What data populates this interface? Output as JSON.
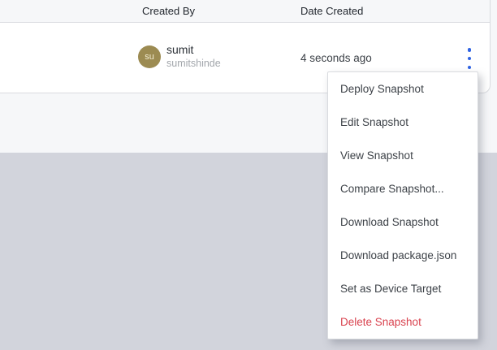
{
  "table": {
    "columns": [
      "Created By",
      "Date Created"
    ],
    "row": {
      "user": {
        "avatar_initials": "su",
        "name": "sumit",
        "username": "sumitshinde"
      },
      "date_created": "4 seconds ago"
    }
  },
  "menu": {
    "items": [
      {
        "label": "Deploy Snapshot",
        "danger": false
      },
      {
        "label": "Edit Snapshot",
        "danger": false
      },
      {
        "label": "View Snapshot",
        "danger": false
      },
      {
        "label": "Compare Snapshot...",
        "danger": false
      },
      {
        "label": "Download Snapshot",
        "danger": false
      },
      {
        "label": "Download package.json",
        "danger": false
      },
      {
        "label": "Set as Device Target",
        "danger": false
      },
      {
        "label": "Delete Snapshot",
        "danger": true
      }
    ]
  },
  "icons": {
    "kebab": "kebab-menu-icon"
  },
  "colors": {
    "header_bg": "#f6f7f9",
    "border": "#d9dbdf",
    "page_light": "#f6f7f9",
    "page_dark": "#d2d4dc",
    "avatar_bg": "#9c8b52",
    "avatar_text": "#f3edd3",
    "name_text": "#2b3036",
    "username_text": "#a3a7ac",
    "menu_text": "#3d4248",
    "header_text": "#22272e",
    "accent_blue": "#2f63e3",
    "danger_red": "#d9434f",
    "body_text": "#3c4147"
  }
}
